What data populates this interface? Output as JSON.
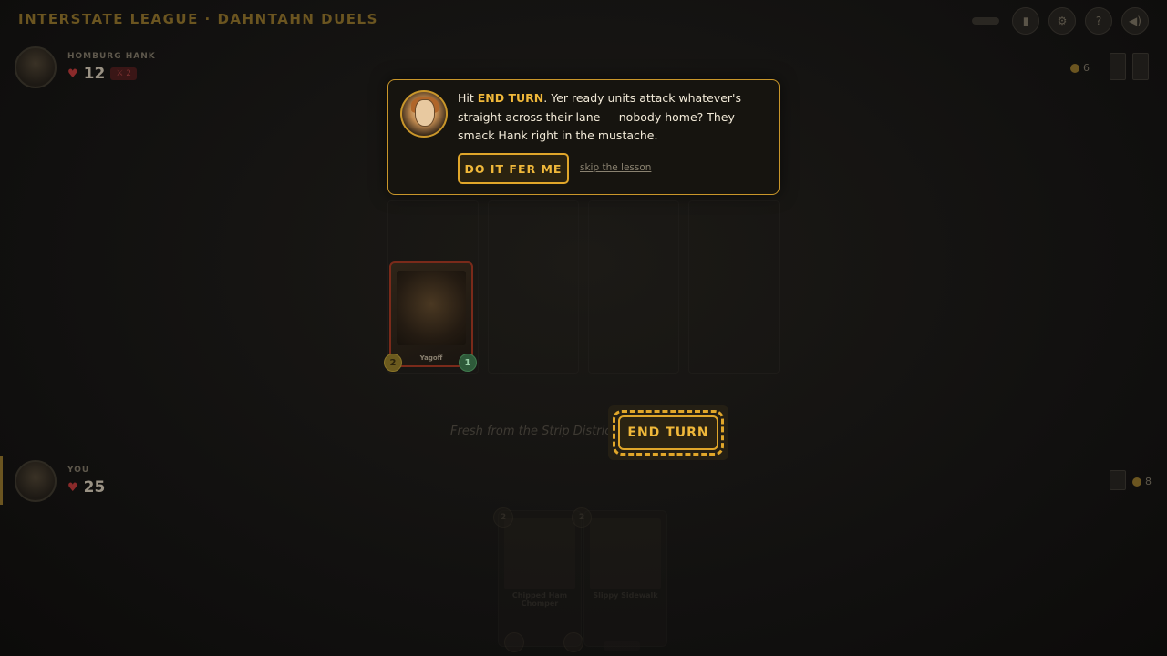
{
  "header": {
    "title": "INTERSTATE LEAGUE · DAHNTAHN DUELS",
    "icons": [
      "deck-icon",
      "gear-icon",
      "help-icon",
      "sound-icon"
    ]
  },
  "opponent": {
    "name": "HOMBURG HANK",
    "hp": "12",
    "attack_badge": "⚔ 2",
    "coins": "6"
  },
  "player": {
    "name": "YOU",
    "hp": "25",
    "coins": "8"
  },
  "board": {
    "unit": {
      "name": "Yagoff",
      "attack": "2",
      "health": "1"
    }
  },
  "flavor_text": "Fresh from the Strip District",
  "end_turn_label": "END TURN",
  "hand": [
    {
      "name": "Chipped Ham Chomper",
      "cost": "2",
      "text": ""
    },
    {
      "name": "Slippy Sidewalk",
      "cost": "2",
      "text": ""
    }
  ],
  "tutorial": {
    "text_before": "Hit ",
    "keyword": "END TURN",
    "text_after": ". Yer ready units attack whatever's straight across their lane — nobody home? They smack Hank right in the mustache.",
    "do_it_label": "DO IT FER ME",
    "skip_label": "skip the lesson"
  },
  "colors": {
    "accent": "#e0a62a",
    "background": "#121110"
  }
}
